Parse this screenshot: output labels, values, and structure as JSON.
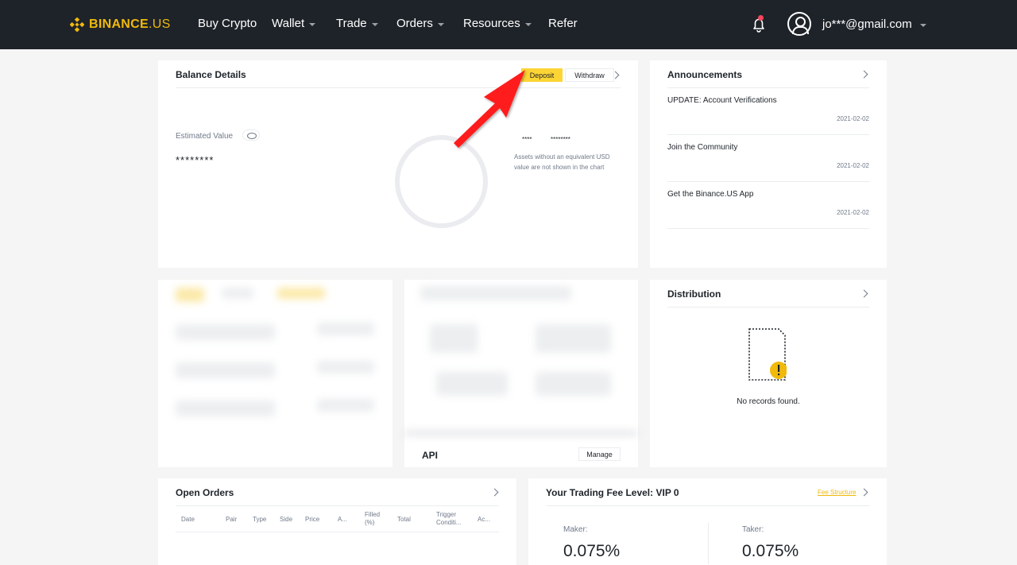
{
  "brand": {
    "name_bold": "BINANCE",
    "name_suffix": ".US",
    "color": "#f0b90b"
  },
  "nav": {
    "items": [
      {
        "label": "Buy Crypto",
        "has_caret": false
      },
      {
        "label": "Wallet",
        "has_caret": true
      },
      {
        "label": "Trade",
        "has_caret": true
      },
      {
        "label": "Orders",
        "has_caret": true
      },
      {
        "label": "Resources",
        "has_caret": true
      },
      {
        "label": "Refer",
        "has_caret": false
      }
    ],
    "user_email": "jo***@gmail.com",
    "icons": [
      "bell-icon",
      "user-avatar-icon",
      "chevron-down-icon"
    ]
  },
  "balance": {
    "title": "Balance Details",
    "deposit_label": "Deposit",
    "withdraw_label": "Withdraw",
    "estimated_label": "Estimated Value",
    "estimated_value": "********",
    "legend_a": "****",
    "legend_b": "********",
    "note": "Assets without an equivalent USD value are not shown in the chart"
  },
  "announcements": {
    "title": "Announcements",
    "items": [
      {
        "title": "UPDATE: Account Verifications",
        "date": "2021-02-02"
      },
      {
        "title": "Join the Community",
        "date": "2021-02-02"
      },
      {
        "title": "Get the Binance.US App",
        "date": "2021-02-02"
      }
    ]
  },
  "api": {
    "label": "API",
    "manage_label": "Manage"
  },
  "distribution": {
    "title": "Distribution",
    "empty_text": "No records found."
  },
  "open_orders": {
    "title": "Open Orders",
    "columns": [
      "Date",
      "Pair",
      "Type",
      "Side",
      "Price",
      "A...",
      "Filled (%)",
      "Total",
      "Trigger Conditi...",
      "Ac..."
    ]
  },
  "fees": {
    "title": "Your Trading Fee Level: VIP 0",
    "link": "Fee Structure",
    "maker_label": "Maker:",
    "maker_value": "0.075%",
    "taker_label": "Taker:",
    "taker_value": "0.075%"
  },
  "colors": {
    "nav_bg": "#1e2329",
    "accent": "#fcd535",
    "annotation_arrow": "#ff1a1a"
  }
}
